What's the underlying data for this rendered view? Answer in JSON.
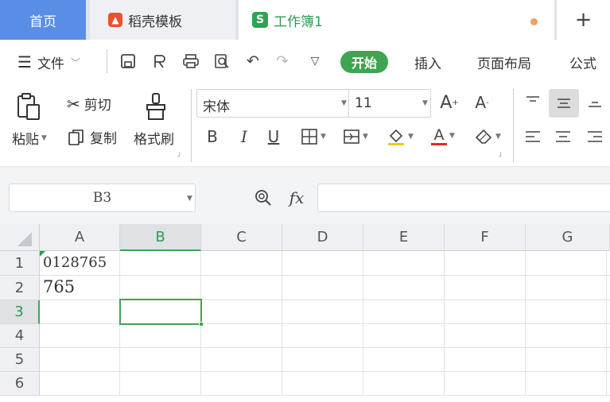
{
  "tabs": {
    "home": "首页",
    "docer": "稻壳模板",
    "workbook": "工作簿1",
    "new_tab": "+"
  },
  "menu": {
    "file": "文件",
    "start": "开始",
    "insert": "插入",
    "page_layout": "页面布局",
    "formula": "公式"
  },
  "ribbon": {
    "paste": "粘贴",
    "cut": "剪切",
    "copy": "复制",
    "format_painter": "格式刷",
    "font_name": "宋体",
    "font_size": "11",
    "bold": "B",
    "italic": "I",
    "underline": "U",
    "font_color_glyph": "A",
    "grow_font": "A",
    "shrink_font": "A"
  },
  "formula_bar": {
    "name_box": "B3",
    "fx": "fx",
    "value": ""
  },
  "grid": {
    "columns": [
      "A",
      "B",
      "C",
      "D",
      "E",
      "F",
      "G"
    ],
    "rows": [
      "1",
      "2",
      "3",
      "4",
      "5",
      "6"
    ],
    "cells": {
      "A1": "0128765",
      "A2": "765"
    },
    "selected_cell": "B3"
  },
  "colors": {
    "accent_green": "#3fa552",
    "home_tab_blue": "#5a8de6",
    "modified_dot": "#f0a25a"
  }
}
